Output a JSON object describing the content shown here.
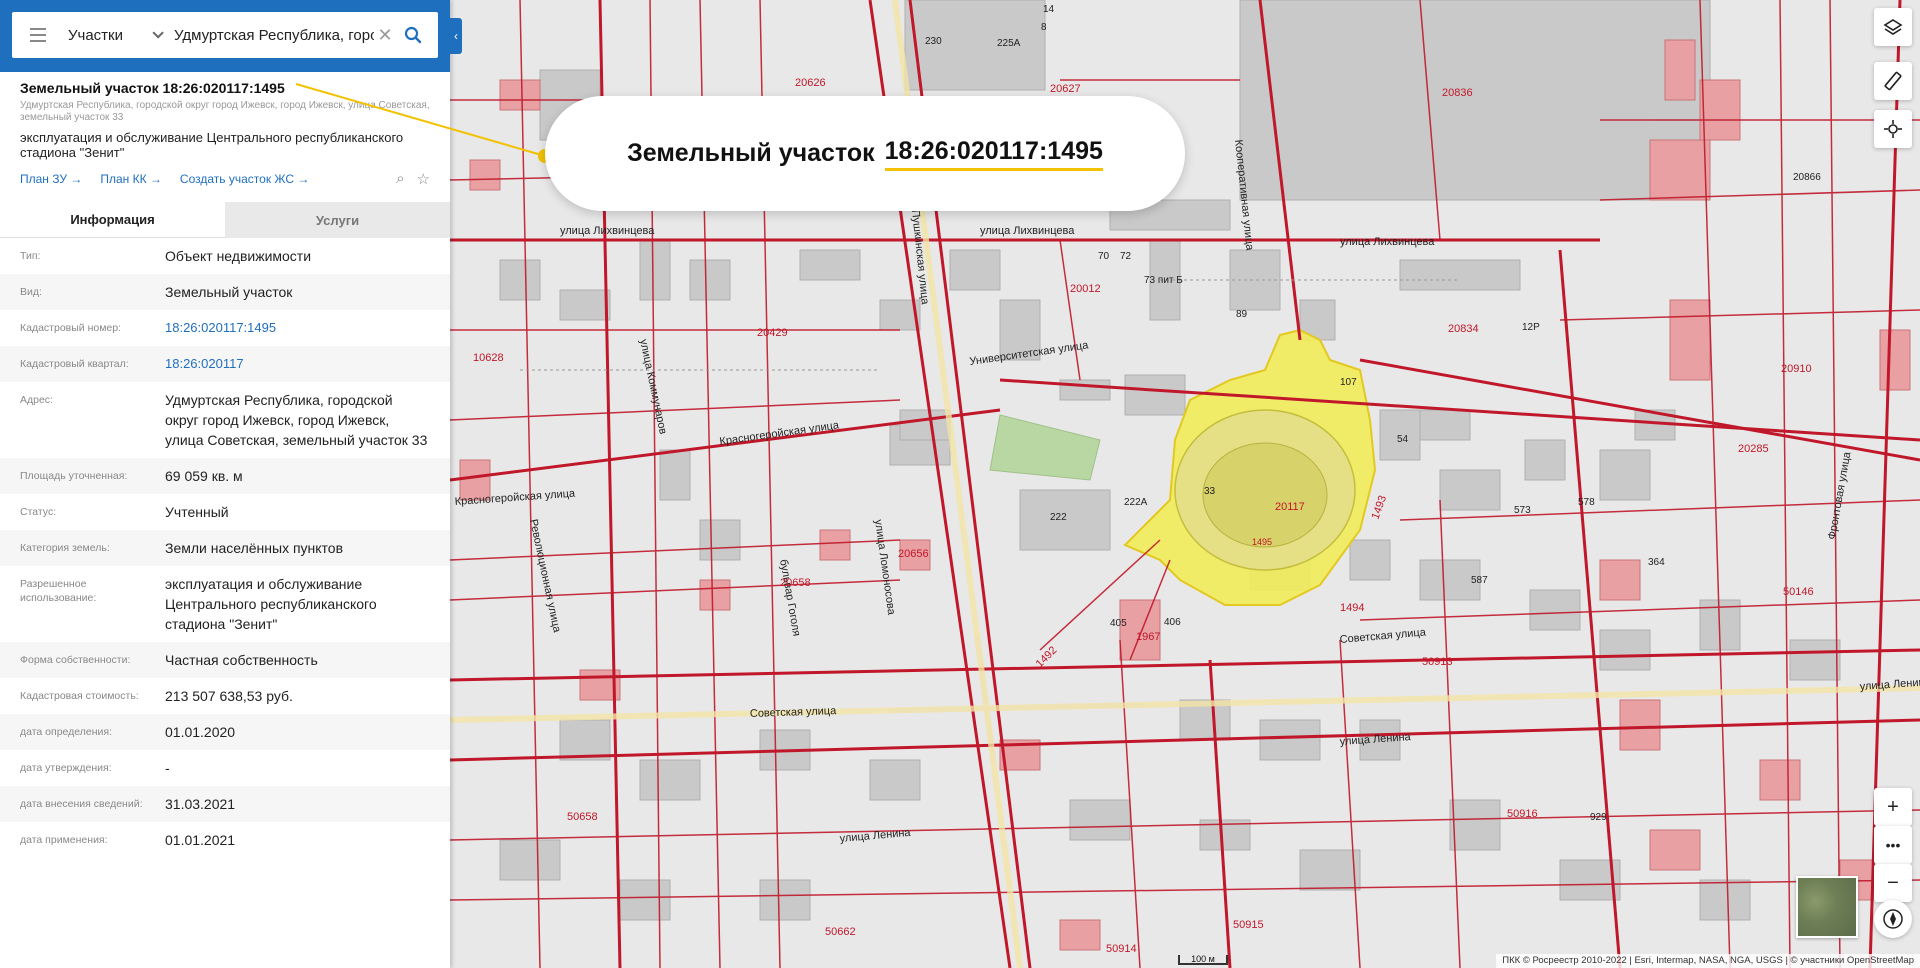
{
  "search": {
    "type_label": "Участки",
    "query": "Удмуртская Республика, город"
  },
  "object": {
    "title": "Земельный участок 18:26:020117:1495",
    "address": "Удмуртская Республика, городской округ город Ижевск, город Ижевск, улица Советская, земельный участок 33",
    "purpose": "эксплуатация и обслуживание Центрального республиканского стадиона \"Зенит\"",
    "links": [
      "План ЗУ →",
      "План КК →",
      "Создать участок ЖС →"
    ]
  },
  "tabs": [
    "Информация",
    "Услуги"
  ],
  "info": [
    {
      "label": "Тип:",
      "value": "Объект недвижимости",
      "link": false
    },
    {
      "label": "Вид:",
      "value": "Земельный участок",
      "link": false
    },
    {
      "label": "Кадастровый номер:",
      "value": "18:26:020117:1495",
      "link": true
    },
    {
      "label": "Кадастровый квартал:",
      "value": "18:26:020117",
      "link": true
    },
    {
      "label": "Адрес:",
      "value": "Удмуртская Республика, городской округ город Ижевск, город Ижевск, улица Советская, земельный участок 33",
      "link": false
    },
    {
      "label": "Площадь уточненная:",
      "value": "69 059 кв. м",
      "link": false
    },
    {
      "label": "Статус:",
      "value": "Учтенный",
      "link": false
    },
    {
      "label": "Категория земель:",
      "value": "Земли населённых пунктов",
      "link": false
    },
    {
      "label": "Разрешенное использование:",
      "value": "эксплуатация и обслуживание Центрального республиканского стадиона \"Зенит\"",
      "link": false
    },
    {
      "label": "Форма собственности:",
      "value": "Частная собственность",
      "link": false
    },
    {
      "label": "Кадастровая стоимость:",
      "value": "213 507 638,53 руб.",
      "link": false
    },
    {
      "label": "дата определения:",
      "value": "01.01.2020",
      "link": false
    },
    {
      "label": "дата утверждения:",
      "value": "-",
      "link": false
    },
    {
      "label": "дата внесения сведений:",
      "value": "31.03.2021",
      "link": false
    },
    {
      "label": "дата применения:",
      "value": "01.01.2021",
      "link": false
    }
  ],
  "callout": {
    "prefix": "Земельный участок",
    "number": "18:26:020117:1495"
  },
  "map": {
    "streets": [
      "улица Лихвинцева",
      "улица Лихвинцева",
      "улица Лихвинцева",
      "Университетская улица",
      "Красногеройская улица",
      "Красногеройская улица",
      "Советская улица",
      "Советская улица",
      "улица Ленина",
      "улица Ленина",
      "улица Ленина",
      "улица Коммунаров",
      "бульвар Гоголя",
      "улица Ломоносова",
      "Пушкинская улица",
      "Кооперативная улица",
      "Фронтовая улица",
      "Революционная улица"
    ],
    "labels": [
      "20627",
      "20626",
      "20836",
      "20012",
      "20834",
      "20910",
      "10628",
      "20117",
      "1495",
      "20656",
      "50913",
      "50916",
      "50915",
      "50914",
      "50658",
      "50662",
      "50146",
      "1967",
      "20285",
      "20429",
      "20658",
      "1493",
      "1494",
      "1492",
      "33",
      "222",
      "222А",
      "405",
      "406",
      "54",
      "230",
      "225А",
      "20866",
      "8",
      "14",
      "70",
      "72",
      "73 пит Б",
      "89",
      "107",
      "12Р",
      "573",
      "578",
      "587",
      "364",
      "929"
    ],
    "scale": "100 м",
    "attribution": "ПКК © Росреестр 2010-2022 | Esri, Intermap, NASA, NGA, USGS | © участники OpenStreetMap"
  },
  "colors": {
    "header_blue": "#1f6fbf",
    "parcel_red": "#c0182a",
    "highlight_yellow": "#f2ec5a",
    "building_gray": "#c9c9c9",
    "building_red": "#e8a0a3"
  },
  "controls": [
    "layers-icon",
    "ruler-icon",
    "locate-icon",
    "zoom-in",
    "more",
    "zoom-out",
    "compass-icon"
  ]
}
